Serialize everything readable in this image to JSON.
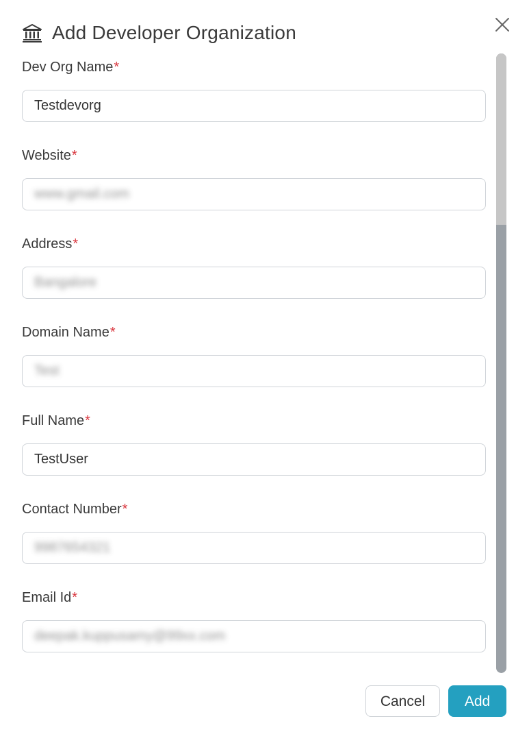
{
  "dialog": {
    "title": "Add Developer Organization",
    "title_icon": "bank-icon",
    "close_icon": "close-icon"
  },
  "fields": [
    {
      "label": "Dev Org Name",
      "value": "Testdevorg",
      "blurred": false,
      "required_mark": "*"
    },
    {
      "label": "Website",
      "value": "www.gmail.com",
      "blurred": true,
      "required_mark": "*"
    },
    {
      "label": "Address",
      "value": "Bangalore",
      "blurred": true,
      "required_mark": "*"
    },
    {
      "label": "Domain Name",
      "value": "Test",
      "blurred": true,
      "required_mark": "*"
    },
    {
      "label": "Full Name",
      "value": "TestUser",
      "blurred": false,
      "required_mark": "*"
    },
    {
      "label": "Contact Number",
      "value": "9987654321",
      "blurred": true,
      "required_mark": "*"
    },
    {
      "label": "Email Id",
      "value": "deepak.kuppusamy@99xx.com",
      "blurred": true,
      "required_mark": "*"
    }
  ],
  "buttons": {
    "cancel_label": "Cancel",
    "add_label": "Add"
  },
  "colors": {
    "primary": "#24a0c0",
    "required": "#d9363e",
    "border": "#cfd3d8"
  }
}
